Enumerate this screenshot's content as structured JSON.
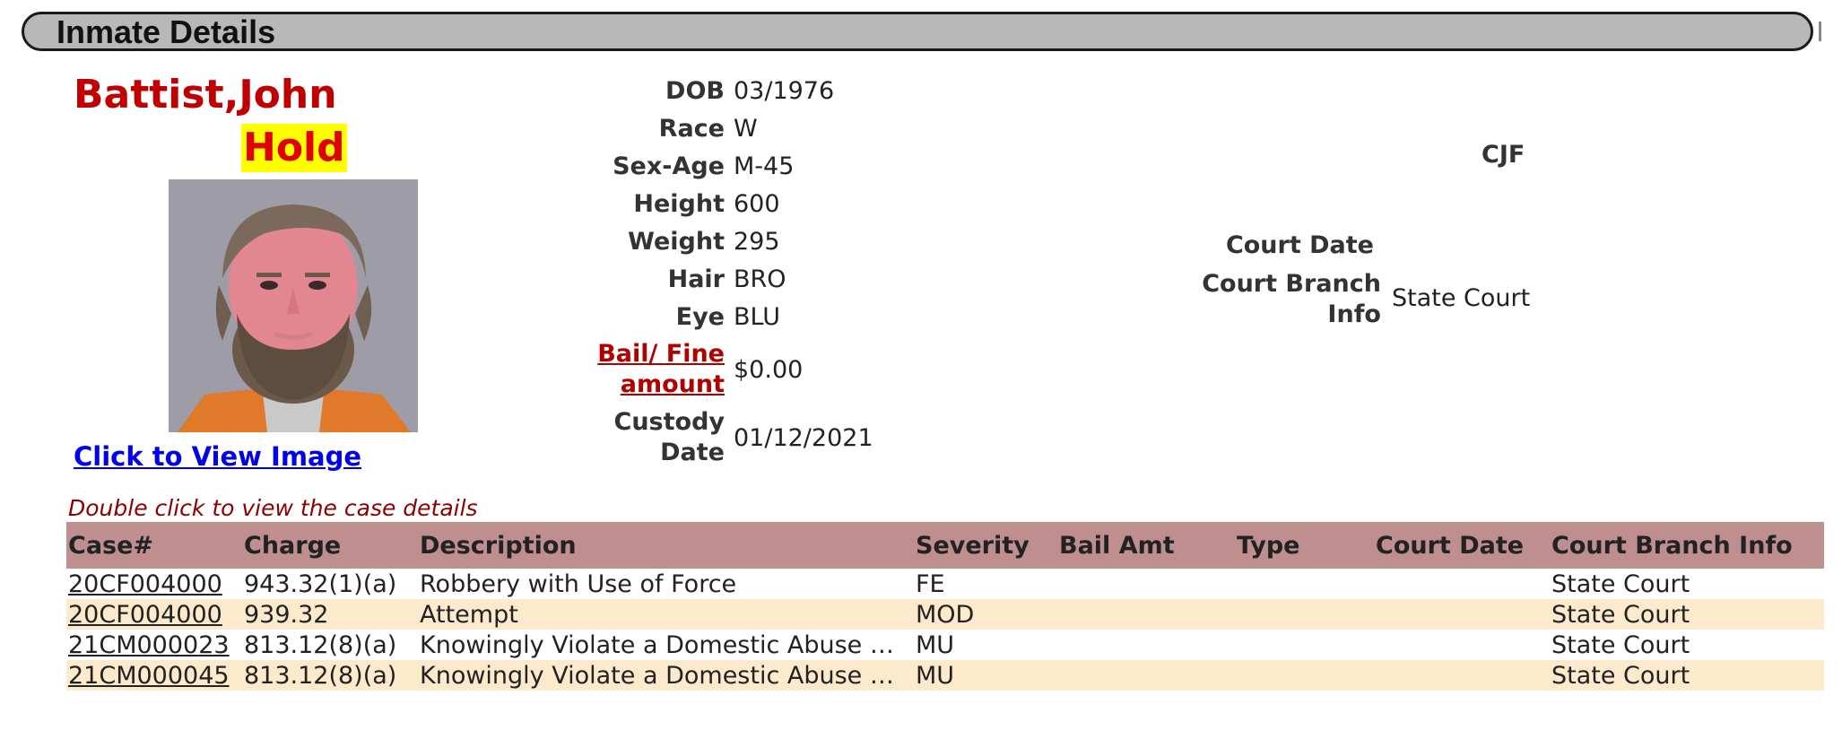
{
  "header": {
    "title": "Inmate Details"
  },
  "inmate": {
    "name": "Battist,John",
    "status": "Hold",
    "view_image_link": "Click to View Image"
  },
  "details": [
    {
      "label": "DOB",
      "value": "03/1976"
    },
    {
      "label": "Race",
      "value": "W"
    },
    {
      "label": "Sex-Age",
      "value": "M-45"
    },
    {
      "label": "Height",
      "value": "600"
    },
    {
      "label": "Weight",
      "value": "295"
    },
    {
      "label": "Hair",
      "value": "BRO"
    },
    {
      "label": "Eye",
      "value": "BLU"
    }
  ],
  "bail": {
    "label": "Bail/ Fine amount",
    "value": "$0.00"
  },
  "custody": {
    "label": "Custody Date",
    "value": "01/12/2021"
  },
  "facility": {
    "label": "CJF"
  },
  "court": {
    "date_label": "Court Date",
    "branch_label": "Court Branch Info",
    "branch_value": "State Court"
  },
  "cases_hint": "Double click to view the case details",
  "cases_table": {
    "headers": [
      "Case#",
      "Charge",
      "Description",
      "Severity",
      "Bail Amt",
      "Type",
      "Court Date",
      "Court Branch Info"
    ],
    "rows": [
      [
        "20CF004000",
        "943.32(1)(a)",
        "Robbery with Use of Force",
        "FE",
        "",
        "",
        "",
        "State Court"
      ],
      [
        "20CF004000",
        "939.32",
        "Attempt",
        "MOD",
        "",
        "",
        "",
        "State Court"
      ],
      [
        "21CM000023",
        "813.12(8)(a)",
        "Knowingly Violate a Domestic Abuse …",
        "MU",
        "",
        "",
        "",
        "State Court"
      ],
      [
        "21CM000045",
        "813.12(8)(a)",
        "Knowingly Violate a Domestic Abuse …",
        "MU",
        "",
        "",
        "",
        "State Court"
      ]
    ]
  },
  "colors": {
    "name_red": "#c00000",
    "hold_bg": "#ffff00",
    "table_header_bg": "#bf8e8e",
    "row_alt_bg": "#fde9cc",
    "header_bar_bg": "#b8b8b8"
  }
}
